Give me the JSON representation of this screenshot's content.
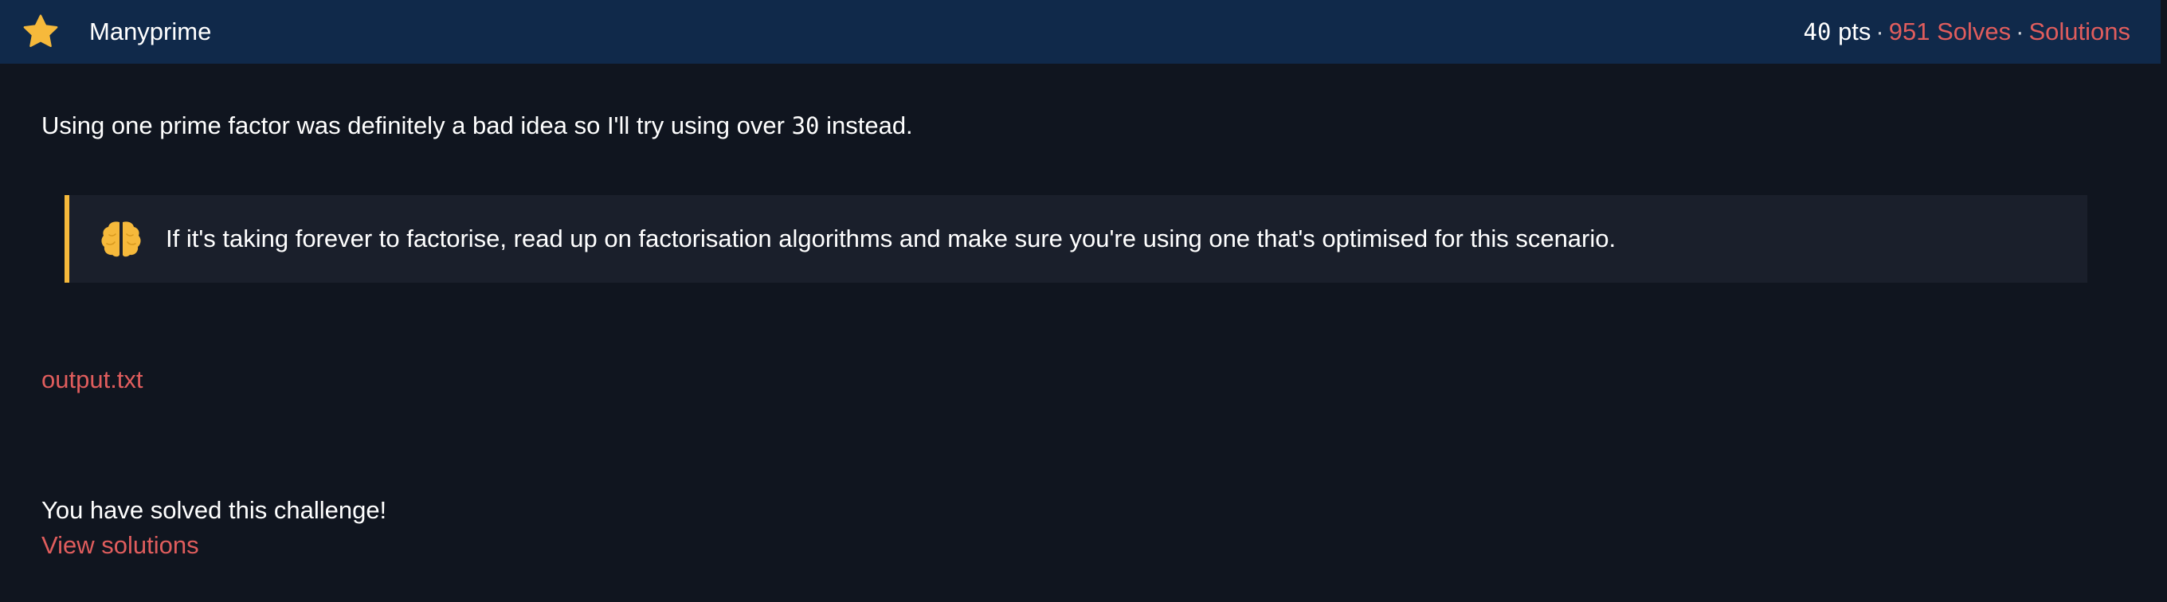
{
  "header": {
    "icon": "star-icon",
    "title": "Manyprime",
    "points_value": "40",
    "points_unit": "pts",
    "separator": "·",
    "solves_label": "951 Solves",
    "solutions_label": "Solutions"
  },
  "description": {
    "before": "Using one prime factor was definitely a bad idea so I'll try using over ",
    "code": "30",
    "after": " instead."
  },
  "hint": {
    "icon": "brain-icon",
    "text": "If it's taking forever to factorise, read up on factorisation algorithms and make sure you're using one that's optimised for this scenario."
  },
  "files": {
    "output_link": "output.txt"
  },
  "status": {
    "solved_text": "You have solved this challenge!",
    "view_solutions_label": "View solutions"
  },
  "colors": {
    "header_bg": "#10294a",
    "page_bg": "#10151f",
    "link": "#e05d5d",
    "hint_accent": "#f6b93b",
    "hint_bg": "#1a1f2b",
    "star": "#f6b93b"
  }
}
